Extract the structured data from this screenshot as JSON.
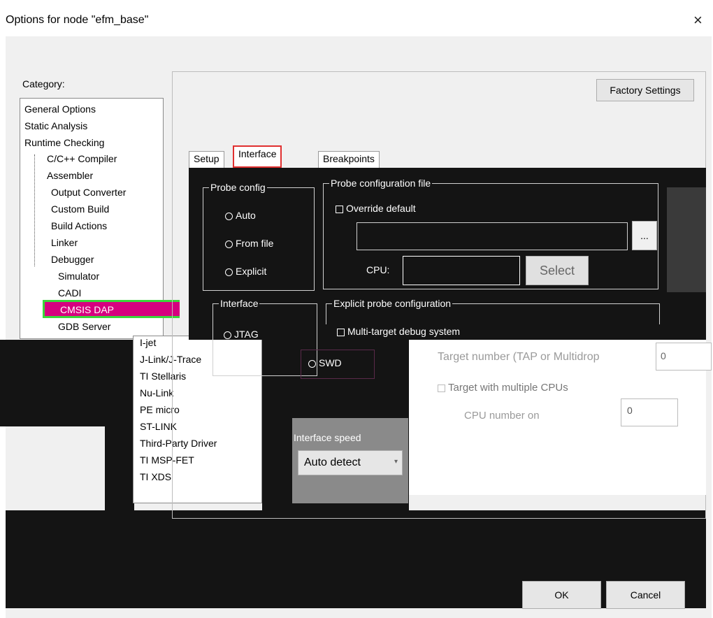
{
  "window": {
    "title": "Options for node \"efm_base\"",
    "close_glyph": "×"
  },
  "category": {
    "label": "Category:",
    "items": [
      "General Options",
      "Static Analysis",
      "Runtime Checking",
      "C/C++ Compiler",
      "Assembler",
      "Output Converter",
      "Custom Build",
      "Build Actions",
      "Linker",
      "Debugger",
      "Simulator",
      "CADI",
      "CMSIS DAP",
      "GDB Server"
    ],
    "selected": "CMSIS DAP"
  },
  "drivers": [
    "I-jet",
    "J-Link/J-Trace",
    "TI Stellaris",
    "Nu-Link",
    "PE micro",
    "ST-LINK",
    "Third-Party Driver",
    "TI MSP-FET",
    "TI XDS"
  ],
  "factory_settings": "Factory Settings",
  "tabs": {
    "setup": "Setup",
    "interface": "Interface",
    "breakpoints": "Breakpoints",
    "active": "Interface"
  },
  "probe_config": {
    "title": "Probe config",
    "options": [
      "Auto",
      "From file",
      "Explicit"
    ]
  },
  "probe_config_file": {
    "title": "Probe configuration file",
    "override": "Override default",
    "browse": "...",
    "cpu_label": "CPU:",
    "select": "Select"
  },
  "interface_group": {
    "title": "Interface",
    "options": [
      "JTAG",
      "SWD"
    ],
    "selected": "SWD"
  },
  "explicit_probe": {
    "title": "Explicit probe configuration",
    "multi_target": "Multi-target debug system",
    "target_number_label": "Target number (TAP or Multidrop",
    "target_number_value": "0",
    "multiple_cpus": "Target with multiple CPUs",
    "cpu_number_label": "CPU number on",
    "cpu_number_value": "0"
  },
  "interface_speed": {
    "label": "Interface speed",
    "value": "Auto detect"
  },
  "footer": {
    "ok": "OK",
    "cancel": "Cancel"
  },
  "colors": {
    "selected_bg": "#d6007f",
    "selected_outline": "#3bd63b",
    "active_tab_outline": "#e03030"
  }
}
